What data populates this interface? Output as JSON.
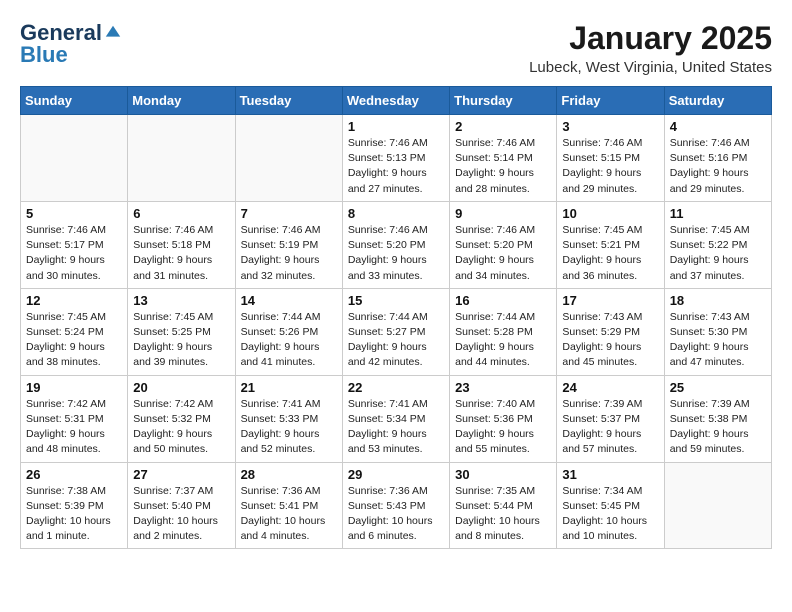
{
  "header": {
    "logo_general": "General",
    "logo_blue": "Blue",
    "month_year": "January 2025",
    "location": "Lubeck, West Virginia, United States"
  },
  "days_of_week": [
    "Sunday",
    "Monday",
    "Tuesday",
    "Wednesday",
    "Thursday",
    "Friday",
    "Saturday"
  ],
  "weeks": [
    [
      {
        "day": "",
        "info": ""
      },
      {
        "day": "",
        "info": ""
      },
      {
        "day": "",
        "info": ""
      },
      {
        "day": "1",
        "info": "Sunrise: 7:46 AM\nSunset: 5:13 PM\nDaylight: 9 hours\nand 27 minutes."
      },
      {
        "day": "2",
        "info": "Sunrise: 7:46 AM\nSunset: 5:14 PM\nDaylight: 9 hours\nand 28 minutes."
      },
      {
        "day": "3",
        "info": "Sunrise: 7:46 AM\nSunset: 5:15 PM\nDaylight: 9 hours\nand 29 minutes."
      },
      {
        "day": "4",
        "info": "Sunrise: 7:46 AM\nSunset: 5:16 PM\nDaylight: 9 hours\nand 29 minutes."
      }
    ],
    [
      {
        "day": "5",
        "info": "Sunrise: 7:46 AM\nSunset: 5:17 PM\nDaylight: 9 hours\nand 30 minutes."
      },
      {
        "day": "6",
        "info": "Sunrise: 7:46 AM\nSunset: 5:18 PM\nDaylight: 9 hours\nand 31 minutes."
      },
      {
        "day": "7",
        "info": "Sunrise: 7:46 AM\nSunset: 5:19 PM\nDaylight: 9 hours\nand 32 minutes."
      },
      {
        "day": "8",
        "info": "Sunrise: 7:46 AM\nSunset: 5:20 PM\nDaylight: 9 hours\nand 33 minutes."
      },
      {
        "day": "9",
        "info": "Sunrise: 7:46 AM\nSunset: 5:20 PM\nDaylight: 9 hours\nand 34 minutes."
      },
      {
        "day": "10",
        "info": "Sunrise: 7:45 AM\nSunset: 5:21 PM\nDaylight: 9 hours\nand 36 minutes."
      },
      {
        "day": "11",
        "info": "Sunrise: 7:45 AM\nSunset: 5:22 PM\nDaylight: 9 hours\nand 37 minutes."
      }
    ],
    [
      {
        "day": "12",
        "info": "Sunrise: 7:45 AM\nSunset: 5:24 PM\nDaylight: 9 hours\nand 38 minutes."
      },
      {
        "day": "13",
        "info": "Sunrise: 7:45 AM\nSunset: 5:25 PM\nDaylight: 9 hours\nand 39 minutes."
      },
      {
        "day": "14",
        "info": "Sunrise: 7:44 AM\nSunset: 5:26 PM\nDaylight: 9 hours\nand 41 minutes."
      },
      {
        "day": "15",
        "info": "Sunrise: 7:44 AM\nSunset: 5:27 PM\nDaylight: 9 hours\nand 42 minutes."
      },
      {
        "day": "16",
        "info": "Sunrise: 7:44 AM\nSunset: 5:28 PM\nDaylight: 9 hours\nand 44 minutes."
      },
      {
        "day": "17",
        "info": "Sunrise: 7:43 AM\nSunset: 5:29 PM\nDaylight: 9 hours\nand 45 minutes."
      },
      {
        "day": "18",
        "info": "Sunrise: 7:43 AM\nSunset: 5:30 PM\nDaylight: 9 hours\nand 47 minutes."
      }
    ],
    [
      {
        "day": "19",
        "info": "Sunrise: 7:42 AM\nSunset: 5:31 PM\nDaylight: 9 hours\nand 48 minutes."
      },
      {
        "day": "20",
        "info": "Sunrise: 7:42 AM\nSunset: 5:32 PM\nDaylight: 9 hours\nand 50 minutes."
      },
      {
        "day": "21",
        "info": "Sunrise: 7:41 AM\nSunset: 5:33 PM\nDaylight: 9 hours\nand 52 minutes."
      },
      {
        "day": "22",
        "info": "Sunrise: 7:41 AM\nSunset: 5:34 PM\nDaylight: 9 hours\nand 53 minutes."
      },
      {
        "day": "23",
        "info": "Sunrise: 7:40 AM\nSunset: 5:36 PM\nDaylight: 9 hours\nand 55 minutes."
      },
      {
        "day": "24",
        "info": "Sunrise: 7:39 AM\nSunset: 5:37 PM\nDaylight: 9 hours\nand 57 minutes."
      },
      {
        "day": "25",
        "info": "Sunrise: 7:39 AM\nSunset: 5:38 PM\nDaylight: 9 hours\nand 59 minutes."
      }
    ],
    [
      {
        "day": "26",
        "info": "Sunrise: 7:38 AM\nSunset: 5:39 PM\nDaylight: 10 hours\nand 1 minute."
      },
      {
        "day": "27",
        "info": "Sunrise: 7:37 AM\nSunset: 5:40 PM\nDaylight: 10 hours\nand 2 minutes."
      },
      {
        "day": "28",
        "info": "Sunrise: 7:36 AM\nSunset: 5:41 PM\nDaylight: 10 hours\nand 4 minutes."
      },
      {
        "day": "29",
        "info": "Sunrise: 7:36 AM\nSunset: 5:43 PM\nDaylight: 10 hours\nand 6 minutes."
      },
      {
        "day": "30",
        "info": "Sunrise: 7:35 AM\nSunset: 5:44 PM\nDaylight: 10 hours\nand 8 minutes."
      },
      {
        "day": "31",
        "info": "Sunrise: 7:34 AM\nSunset: 5:45 PM\nDaylight: 10 hours\nand 10 minutes."
      },
      {
        "day": "",
        "info": ""
      }
    ]
  ]
}
